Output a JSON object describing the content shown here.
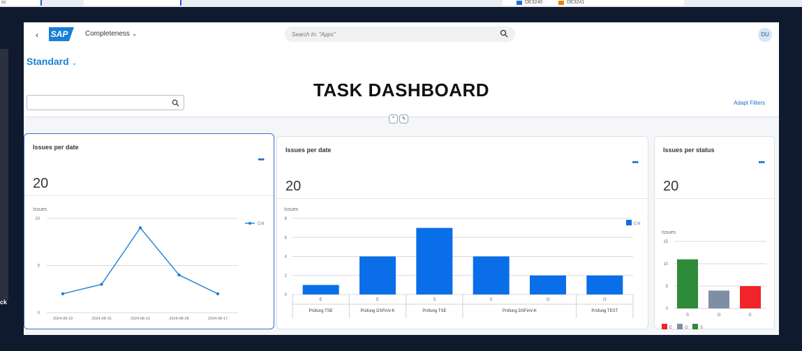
{
  "shell": {
    "app_title": "Completeness",
    "logo_text": "SAP",
    "search_placeholder": "Search In: \"Apps\"",
    "avatar_initials": "DU"
  },
  "header": {
    "variant": "Standard",
    "dashboard_title": "TASK DASHBOARD",
    "adapt_filters": "Adapt Filters"
  },
  "background": {
    "legend_a": "DE3240",
    "legend_b": "DE3241",
    "left_text": "ck",
    "left_small": "sc"
  },
  "cards": [
    {
      "title": "Issues per date",
      "kpi": "20"
    },
    {
      "title": "Issues per date",
      "kpi": "20"
    },
    {
      "title": "Issues per status",
      "kpi": "20"
    }
  ],
  "chart_data": [
    {
      "type": "line",
      "title": "Issues per date",
      "ylabel": "Issues",
      "x": [
        "2024-08-19",
        "2024-08-15",
        "2024-08-16",
        "2024-08-28",
        "2024-08-17"
      ],
      "series": [
        {
          "name": "Cnt",
          "values": [
            2,
            3,
            9,
            4,
            2
          ]
        }
      ],
      "ylim": [
        0,
        10
      ],
      "yticks": [
        0,
        5,
        10
      ],
      "legend": "right",
      "color": "#1a7fd8"
    },
    {
      "type": "bar",
      "title": "Issues per date",
      "ylabel": "Issues",
      "categories": [
        "E",
        "E",
        "S",
        "S",
        "O",
        "O"
      ],
      "groups": [
        {
          "label": "Prüfung TSE",
          "span": 1
        },
        {
          "label": "Prüfung DSFinV-K",
          "span": 1
        },
        {
          "label": "Prüfung TSE",
          "span": 1
        },
        {
          "label": "Prüfung DSFinV-K",
          "span": 2
        },
        {
          "label": "Prüfung TEST",
          "span": 1
        }
      ],
      "series": [
        {
          "name": "Cnt",
          "values": [
            1,
            4,
            7,
            4,
            2,
            2
          ]
        }
      ],
      "ylim": [
        0,
        8
      ],
      "yticks": [
        0,
        2,
        4,
        6,
        8
      ],
      "legend": "top-right",
      "color": "#0a6ee8"
    },
    {
      "type": "bar",
      "title": "Issues per status",
      "ylabel": "Issues",
      "categories": [
        "S",
        "O",
        "E"
      ],
      "values": [
        11,
        4,
        5
      ],
      "colors": [
        "#2e8b3a",
        "#7f8fa3",
        "#f0242a"
      ],
      "ylim": [
        0,
        15
      ],
      "yticks": [
        0,
        5,
        10,
        15
      ],
      "legend_entries": [
        {
          "label": "E",
          "color": "#f0242a"
        },
        {
          "label": "O",
          "color": "#7f8fa3"
        },
        {
          "label": "S",
          "color": "#2e8b3a"
        }
      ],
      "legend": "bottom-left"
    }
  ]
}
